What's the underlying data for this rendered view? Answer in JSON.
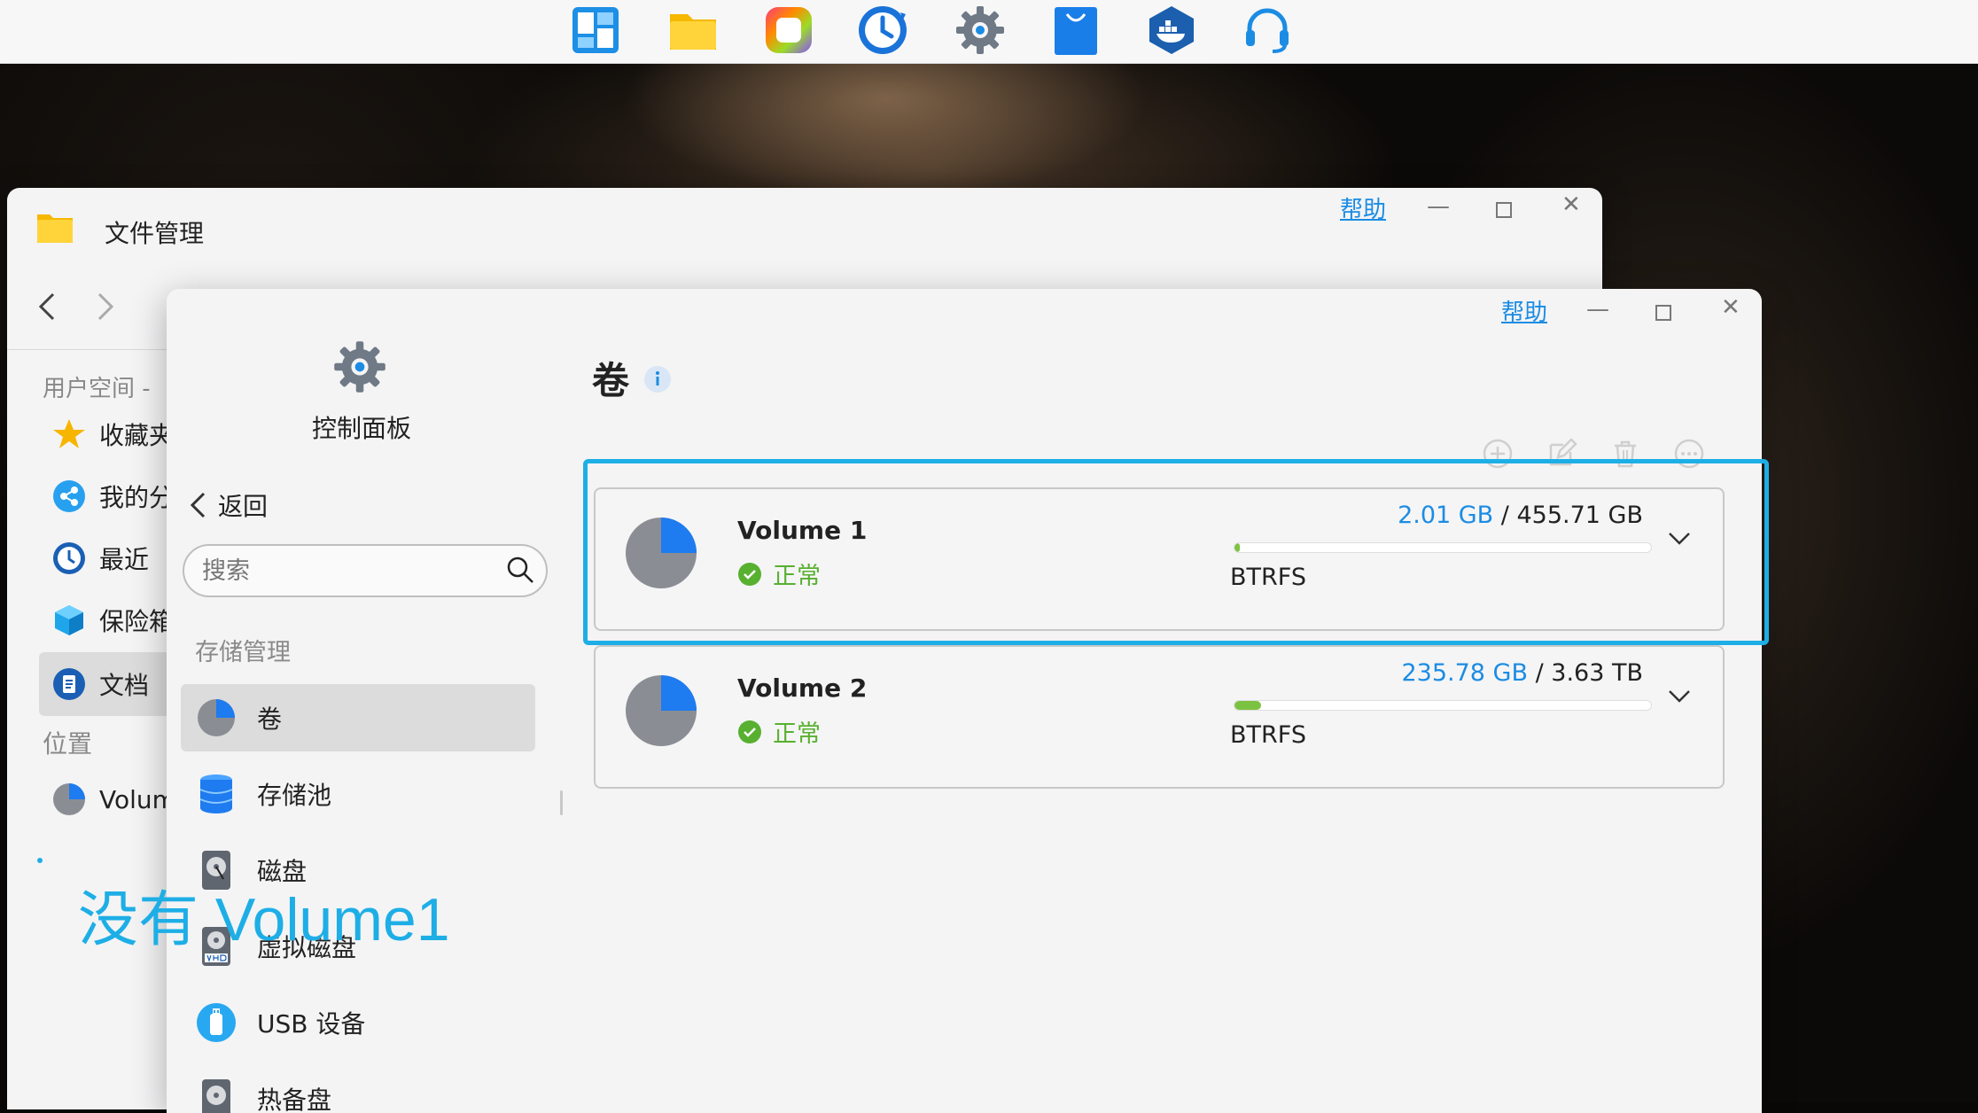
{
  "dock": {
    "apps": [
      {
        "name": "app-center-icon"
      },
      {
        "name": "file-manager-icon"
      },
      {
        "name": "photos-icon"
      },
      {
        "name": "backup-clock-icon"
      },
      {
        "name": "settings-gear-icon"
      },
      {
        "name": "app-store-bag-icon"
      },
      {
        "name": "docker-icon"
      },
      {
        "name": "support-headset-icon"
      }
    ]
  },
  "file_manager": {
    "title": "文件管理",
    "help": "帮助",
    "section_user": "用户空间 - ",
    "nav": [
      {
        "label": "收藏夹"
      },
      {
        "label": "我的分"
      },
      {
        "label": "最近"
      },
      {
        "label": "保险箱"
      },
      {
        "label": "文档"
      }
    ],
    "section_location": "位置",
    "location_item": "Volum"
  },
  "control_panel": {
    "title": "控制面板",
    "help": "帮助",
    "back": "返回",
    "search_placeholder": "搜索",
    "section": "存储管理",
    "sidebar": [
      {
        "label": "卷"
      },
      {
        "label": "存储池"
      },
      {
        "label": "磁盘"
      },
      {
        "label": "虚拟磁盘"
      },
      {
        "label": "USB 设备"
      },
      {
        "label": "热备盘"
      }
    ],
    "page_title": "卷",
    "volumes": [
      {
        "name": "Volume 1",
        "status": "正常",
        "used": "2.01 GB",
        "sep": " / ",
        "total": "455.71 GB",
        "usage_fraction": 0.0044,
        "fs": "BTRFS"
      },
      {
        "name": "Volume 2",
        "status": "正常",
        "used": "235.78 GB",
        "sep": " / ",
        "total": "3.63 TB",
        "usage_fraction": 0.0634,
        "fs": "BTRFS"
      }
    ]
  },
  "annotation": {
    "text": "没有 Volume1",
    "color": "#1eaee6"
  },
  "colors": {
    "accent": "#1b8ce3",
    "ok": "#58b030",
    "bar": "#7cc242",
    "highlight": "#1eaee6"
  }
}
